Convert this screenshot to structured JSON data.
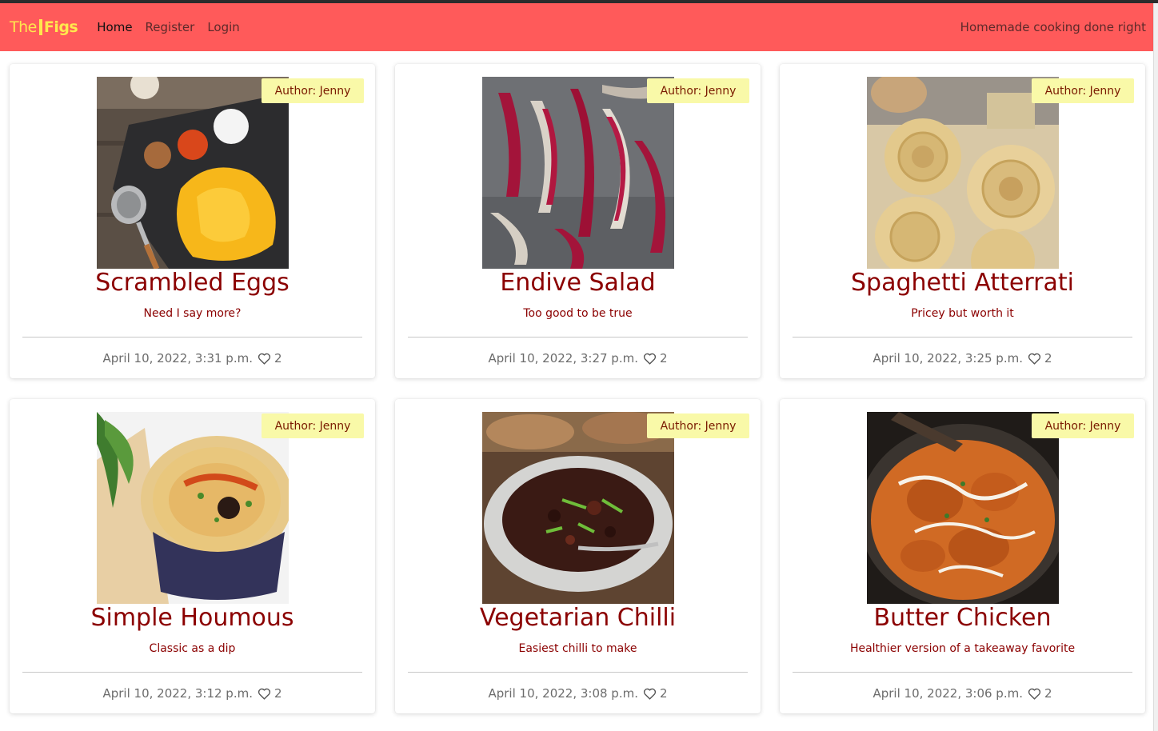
{
  "navbar": {
    "brand_the": "The",
    "brand_figs": "Figs",
    "links": [
      {
        "label": "Home",
        "active": true
      },
      {
        "label": "Register",
        "active": false
      },
      {
        "label": "Login",
        "active": false
      }
    ],
    "tagline": "Homemade cooking done right"
  },
  "colors": {
    "navbar": "#ff5a5a",
    "brand": "#ffe84d",
    "title": "#8b0000",
    "badge_bg": "#f9f9a8"
  },
  "recipes": [
    {
      "author": "Author: Jenny",
      "title": "Scrambled Eggs",
      "description": "Need I say more?",
      "date": "April 10, 2022, 3:31 p.m.",
      "likes": "2",
      "image": "scrambled-eggs-photo"
    },
    {
      "author": "Author: Jenny",
      "title": "Endive Salad",
      "description": "Too good to be true",
      "date": "April 10, 2022, 3:27 p.m.",
      "likes": "2",
      "image": "endive-salad-photo"
    },
    {
      "author": "Author: Jenny",
      "title": "Spaghetti Atterrati",
      "description": "Pricey but worth it",
      "date": "April 10, 2022, 3:25 p.m.",
      "likes": "2",
      "image": "spaghetti-photo"
    },
    {
      "author": "Author: Jenny",
      "title": "Simple Houmous",
      "description": "Classic as a dip",
      "date": "April 10, 2022, 3:12 p.m.",
      "likes": "2",
      "image": "houmous-photo"
    },
    {
      "author": "Author: Jenny",
      "title": "Vegetarian Chilli",
      "description": "Easiest chilli to make",
      "date": "April 10, 2022, 3:08 p.m.",
      "likes": "2",
      "image": "chilli-photo"
    },
    {
      "author": "Author: Jenny",
      "title": "Butter Chicken",
      "description": "Healthier version of a takeaway favorite",
      "date": "April 10, 2022, 3:06 p.m.",
      "likes": "2",
      "image": "butter-chicken-photo"
    }
  ]
}
